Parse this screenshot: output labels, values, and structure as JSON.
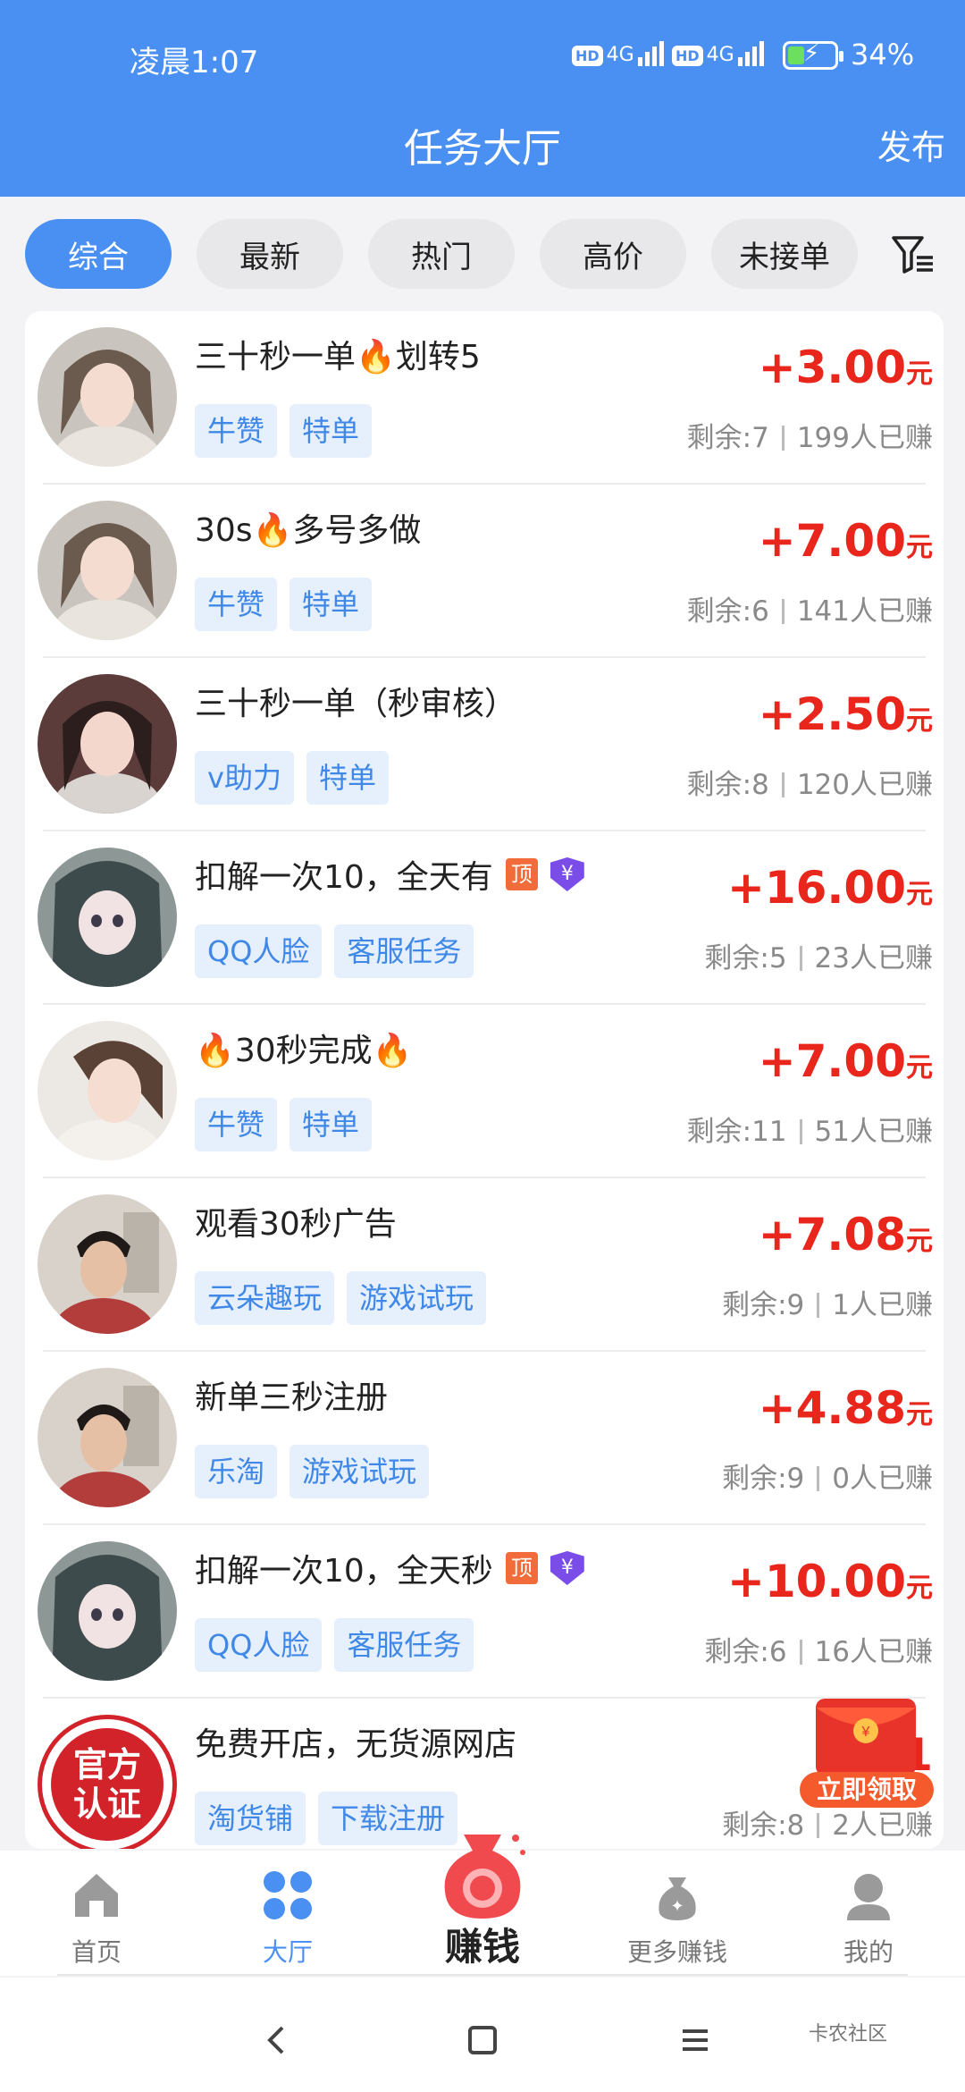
{
  "status": {
    "time": "凌晨1:07",
    "hd1": "HD",
    "net1": "4G",
    "hd2": "HD",
    "net2": "4G",
    "battery": "34%"
  },
  "header": {
    "title": "任务大厅",
    "publish": "发布"
  },
  "filters": [
    "综合",
    "最新",
    "热门",
    "高价",
    "未接单"
  ],
  "tasks": [
    {
      "title": "三十秒一单🔥划转5",
      "tags": [
        "牛赞",
        "特单"
      ],
      "price": "+3.00",
      "unit": "元",
      "remaining": "剩余:7",
      "earned": "199人已赚"
    },
    {
      "title": "30s🔥多号多做",
      "tags": [
        "牛赞",
        "特单"
      ],
      "price": "+7.00",
      "unit": "元",
      "remaining": "剩余:6",
      "earned": "141人已赚"
    },
    {
      "title": "三十秒一单（秒审核）",
      "tags": [
        "v助力",
        "特单"
      ],
      "price": "+2.50",
      "unit": "元",
      "remaining": "剩余:8",
      "earned": "120人已赚"
    },
    {
      "title": "扣解一次10，全天有",
      "badge_top": "顶",
      "badge_yen": "¥",
      "tags": [
        "QQ人脸",
        "客服任务"
      ],
      "price": "+16.00",
      "unit": "元",
      "remaining": "剩余:5",
      "earned": "23人已赚"
    },
    {
      "title": "🔥30秒完成🔥",
      "tags": [
        "牛赞",
        "特单"
      ],
      "price": "+7.00",
      "unit": "元",
      "remaining": "剩余:11",
      "earned": "51人已赚"
    },
    {
      "title": "观看30秒广告",
      "tags": [
        "云朵趣玩",
        "游戏试玩"
      ],
      "price": "+7.08",
      "unit": "元",
      "remaining": "剩余:9",
      "earned": "1人已赚"
    },
    {
      "title": "新单三秒注册",
      "tags": [
        "乐淘",
        "游戏试玩"
      ],
      "price": "+4.88",
      "unit": "元",
      "remaining": "剩余:9",
      "earned": "0人已赚"
    },
    {
      "title": "扣解一次10，全天秒",
      "badge_top": "顶",
      "badge_yen": "¥",
      "tags": [
        "QQ人脸",
        "客服任务"
      ],
      "price": "+10.00",
      "unit": "元",
      "remaining": "剩余:6",
      "earned": "16人已赚"
    },
    {
      "title": "免费开店，无货源网店",
      "avatar_text": "官方认证",
      "tags": [
        "淘货铺",
        "下载注册"
      ],
      "price": "+1",
      "unit": "",
      "remaining": "剩余:8",
      "earned": "2人已赚"
    }
  ],
  "floating": {
    "label": "立即领取"
  },
  "nav": {
    "home": "首页",
    "hall": "大厅",
    "earn": "赚钱",
    "more": "更多赚钱",
    "mine": "我的"
  },
  "watermark": "卡农社区"
}
